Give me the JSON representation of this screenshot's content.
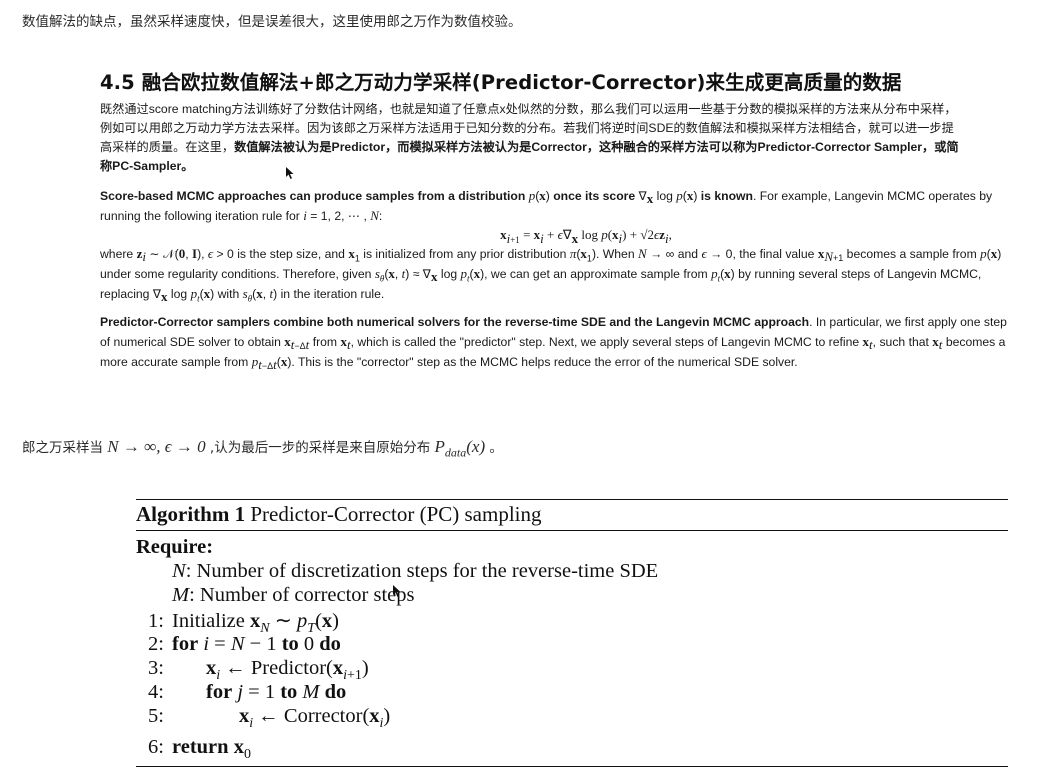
{
  "intro": "数值解法的缺点，虽然采样速度快，但是误差很大，这里使用郎之万作为数值校验。",
  "heading": "4.5 融合欧拉数值解法+郎之万动力学采样(Predictor-Corrector)来生成更高质量的数据",
  "zh_paragraph": {
    "line1": "既然通过score matching方法训练好了分数估计网络，也就是知道了任意点x处似然的分数，那么我们可以运用一些基于分数的模拟采样的方法来从分布中采样，",
    "line2": "例如可以用郎之万动力学方法去采样。因为该郎之万采样方法适用于已知分数的分布。若我们将逆时间SDE的数值解法和模拟采样方法相结合，就可以进一步提",
    "line3_plain": "高采样的质量。在这里，",
    "line3_bold": "数值解法被认为是Predictor，而模拟采样方法被认为是Corrector，这种融合的采样方法可以称为Predictor-Corrector Sampler，或简",
    "line4_bold": "称PC-Sampler。"
  },
  "score_paragraph": {
    "bold_lead": "Score-based MCMC approaches can produce samples from a distribution",
    "bold_mid": "once its score",
    "bold_tail": "is known",
    "sentence2": ". For example, Langevin MCMC operates by running the following iteration rule for",
    "where": "where",
    "is_step": "is the step size, and",
    "init_from": "is initialized from any prior distribution",
    "when": ". When",
    "and": "and",
    "final_value": ", the final value",
    "becomes": "becomes a sample from",
    "regularity": "under some regularity conditions. Therefore, given",
    "approx": ", we can get an approximate sample from",
    "by_running": "by running several steps of Langevin MCMC, replacing",
    "with": "with",
    "in_rule": "in the iteration rule."
  },
  "pc_paragraph": {
    "bold_lead": "Predictor-Corrector samplers combine both numerical solvers for the reverse-time SDE and the Langevin MCMC approach",
    "t1": ". In particular, we first apply one step of numerical SDE solver to obtain",
    "t2": "from",
    "t3": ", which is called the \"predictor\" step. Next, we apply several steps of Langevin MCMC to refine",
    "t4": ", such that",
    "t5": "becomes a more accurate sample from",
    "t6": ". This is the \"corrector\" step as the MCMC helps reduce the error of the numerical SDE solver."
  },
  "note": {
    "prefix": "郎之万采样当",
    "math": "N → ∞, ϵ → 0",
    "middle": ",认为最后一步的采样是来自原始分布",
    "suffix": "。"
  },
  "algorithm": {
    "label": "Algorithm 1",
    "title": "Predictor-Corrector (PC) sampling",
    "require": "Require:",
    "req_n": "Number of discretization steps for the reverse-time SDE",
    "req_m": "Number of corrector steps",
    "steps": [
      {
        "num": "1:",
        "text": "Initialize"
      },
      {
        "num": "2:",
        "kw": "for",
        "kw2": "to",
        "kw3": "do"
      },
      {
        "num": "3:",
        "text": "Predictor"
      },
      {
        "num": "4:",
        "kw": "for",
        "kw2": "to",
        "kw3": "do"
      },
      {
        "num": "5:",
        "text": "Corrector"
      },
      {
        "num": "6:",
        "kw": "return"
      }
    ]
  }
}
